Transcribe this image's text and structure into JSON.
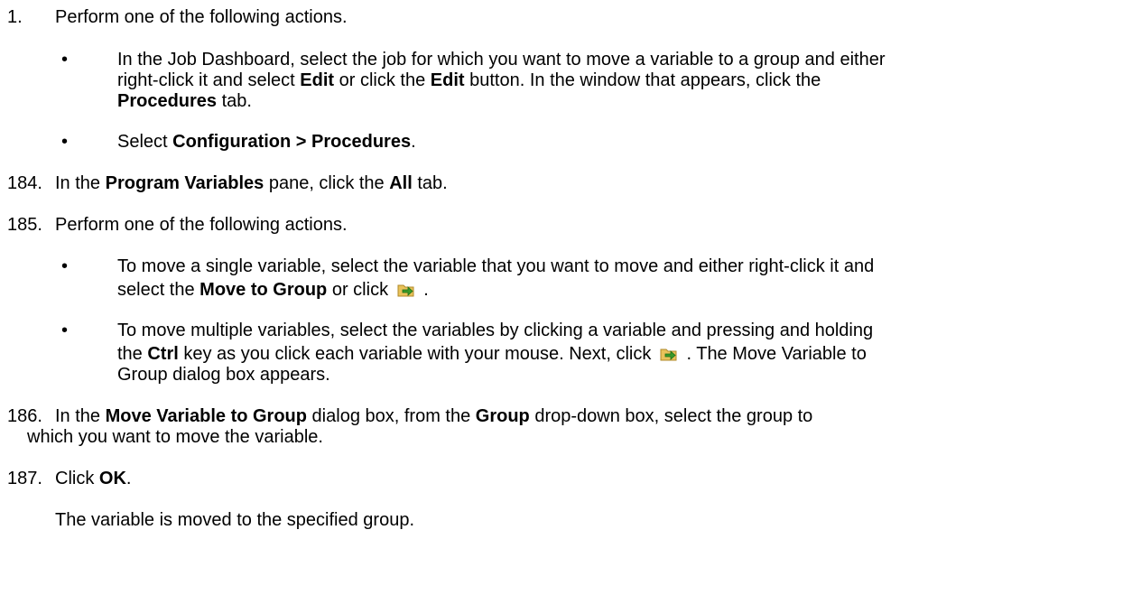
{
  "steps": {
    "s1": {
      "number": "1.",
      "text": "Perform one of the following actions.",
      "bullets": {
        "b1": {
          "l1": "In the Job Dashboard, select the job for which you want to move a variable to a group and either",
          "l2a": "right-click it and select ",
          "l2b": "Edit",
          "l2c": " or click the ",
          "l2d": "Edit",
          "l2e": " button. In the window that appears, click the",
          "l3a": "Procedures",
          "l3b": " tab."
        },
        "b2": {
          "a": "Select ",
          "b": "Configuration > Procedures",
          "c": "."
        }
      }
    },
    "s184": {
      "number": "184.",
      "a": "In the ",
      "b": "Program Variables",
      "c": " pane, click the ",
      "d": "All",
      "e": " tab."
    },
    "s185": {
      "number": "185.",
      "text": "Perform one of the following actions.",
      "bullets": {
        "b1": {
          "l1": "To move a single variable, select the variable that you want to move and either right-click it and",
          "l2a": "select the ",
          "l2b": "Move to Group",
          "l2c": " or click ",
          "l2d": "."
        },
        "b2": {
          "l1": "To move multiple variables, select the variables by clicking a variable and pressing and holding",
          "l2a": "the ",
          "l2b": "Ctrl",
          "l2c": " key as you click each variable with your mouse. Next, click ",
          "l2d": ".  The Move Variable to",
          "l3": "Group dialog box appears."
        }
      }
    },
    "s186": {
      "number": "186.",
      "a": "In the ",
      "b": "Move Variable to Group",
      "c": " dialog box, from the ",
      "d": "Group",
      "e": " drop-down box, select the group to",
      "l2": "which you want to move the variable."
    },
    "s187": {
      "number": "187.",
      "a": "Click ",
      "b": "OK",
      "c": "."
    },
    "result": "The variable is moved to the specified group."
  },
  "icons": {
    "move_to_group": "move-to-group-icon"
  },
  "colors": {
    "icon_folder": "#e9c25a",
    "icon_arrow": "#3a9a2a"
  }
}
